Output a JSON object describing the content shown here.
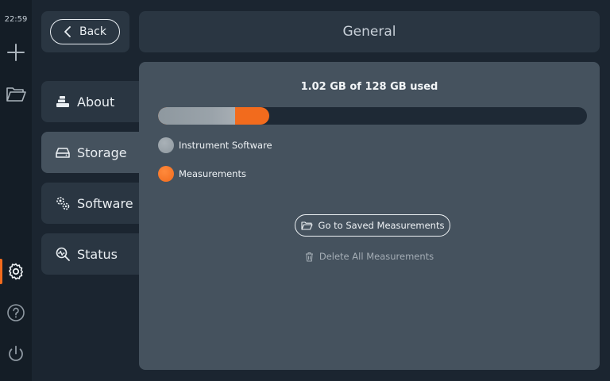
{
  "status_bar": {
    "time": "22:59"
  },
  "rail": {
    "items": [
      {
        "icon": "plus-icon"
      },
      {
        "icon": "folder-icon"
      },
      {
        "icon": "gear-icon",
        "active": true
      },
      {
        "icon": "help-icon"
      },
      {
        "icon": "power-icon"
      }
    ]
  },
  "back_button": {
    "label": "Back",
    "icon": "chevron-left-icon"
  },
  "header": {
    "title": "General"
  },
  "nav": {
    "items": [
      {
        "label": "About",
        "icon": "about-icon"
      },
      {
        "label": "Storage",
        "icon": "storage-icon",
        "active": true
      },
      {
        "label": "Software",
        "icon": "software-icon"
      },
      {
        "label": "Status",
        "icon": "status-icon"
      }
    ]
  },
  "storage": {
    "usage_text": "1.02 GB of 128 GB used",
    "bar": {
      "instrument_fraction": 0.18,
      "total_fraction": 0.26,
      "instrument_color": "#9aa3aa",
      "measurements_color": "#f26b1d"
    },
    "legend": [
      {
        "label": "Instrument Software",
        "color": "#8e989f"
      },
      {
        "label": "Measurements",
        "color": "#f26b1d"
      }
    ],
    "go_saved_label": "Go to Saved Measurements",
    "delete_label": "Delete All Measurements"
  },
  "colors": {
    "accent": "#f26b1d",
    "panel": "#45525e",
    "card": "#2a3642",
    "background": "#1b2530"
  }
}
